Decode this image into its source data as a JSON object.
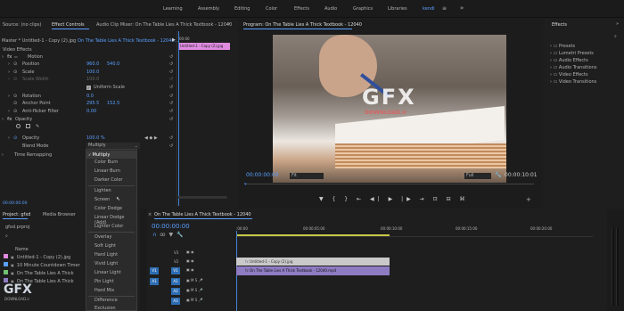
{
  "workspaces": [
    "Learning",
    "Assembly",
    "Editing",
    "Color",
    "Effects",
    "Audio",
    "Graphics",
    "Libraries",
    "kendi"
  ],
  "workspace_more": "»",
  "source_tabs": {
    "source": "Source: (no clips)",
    "effect_controls": "Effect Controls",
    "audio_mixer": "Audio Clip Mixer: On The Table Lies A Thick Textbook - 12040",
    "more": "»"
  },
  "ec_header": {
    "master": "Master * Untitled-1 - Copy (2).jpg",
    "seq": "On The Table Lies A Thick Textbook - 12040...",
    "time": "00:00",
    "clip_label": "Untitled-1 - Copy (2).jpg"
  },
  "video_effects_label": "Video Effects",
  "motion": {
    "label": "Motion",
    "position_label": "Position",
    "position_x": "960.0",
    "position_y": "540.0",
    "scale_label": "Scale",
    "scale_value": "100.0",
    "scale_width_label": "Scale Width",
    "scale_width_value": "100.0",
    "uniform_label": "Uniform Scale",
    "rotation_label": "Rotation",
    "rotation_value": "0.0",
    "anchor_label": "Anchor Point",
    "anchor_x": "295.5",
    "anchor_y": "152.5",
    "antiflicker_label": "Anti-flicker Filter",
    "antiflicker_value": "0.00"
  },
  "opacity": {
    "label": "Opacity",
    "opacity_label": "Opacity",
    "opacity_value": "100.0 %",
    "blend_label": "Blend Mode",
    "blend_value": "Multiply"
  },
  "time_remap_label": "Time Remapping",
  "ec_time": "00:00:00:00",
  "blend_options": [
    "Multiply",
    "Color Burn",
    "Linear Burn",
    "Darker Color",
    "Lighten",
    "Screen",
    "Color Dodge",
    "Linear Dodge (Add)",
    "Lighter Color",
    "Overlay",
    "Soft Light",
    "Hard Light",
    "Vivid Light",
    "Linear Light",
    "Pin Light",
    "Hard Mix",
    "Difference",
    "Exclusion"
  ],
  "program": {
    "title": "Program: On The Table Lies A Thick Textbook - 12040",
    "timecode": "00:00:00:00",
    "fit": "Fit",
    "full": "Full",
    "duration": "00:00:10:01"
  },
  "watermark": {
    "main": "GFX",
    "sub": "DOWNLOAD.ir"
  },
  "effects_panel": {
    "title": "Effects",
    "more": "»",
    "items": [
      "Presets",
      "Lumetri Presets",
      "Audio Effects",
      "Audio Transitions",
      "Video Effects",
      "Video Transitions"
    ]
  },
  "project": {
    "tab": "Project: gfxd",
    "media_browser": "Media Browser",
    "file": "gfxd.prproj",
    "name_header": "Name",
    "items": [
      "Untitled-1 - Copy (2).jpg",
      "10 Minute Countdown Timer",
      "On The Table Lies A Thick",
      "On The Table Lies A Thick"
    ]
  },
  "timeline": {
    "title": "On The Table Lies A Thick Textbook - 12040",
    "timecode": "00:00:00:00",
    "ruler": [
      ":00:00",
      "00:00:05:00",
      "00:00:10:00",
      "00:00:15:00",
      "00:00:20:00"
    ],
    "tracks": [
      "V3",
      "V2",
      "V1",
      "A1",
      "A2",
      "A3"
    ],
    "source_patch": [
      "V1",
      "A1"
    ],
    "clip_v2": "Untitled-1 - Copy (2).jpg",
    "clip_v1": "On The Table Lies A Thick Textbook - 12040.mp4"
  },
  "colors": {
    "accent": "#2d8ceb",
    "clip_pink": "#e08be0",
    "clip_video": "#8e7cc3",
    "clip_image": "#c9c9c9",
    "panel": "#1e1e1e"
  }
}
